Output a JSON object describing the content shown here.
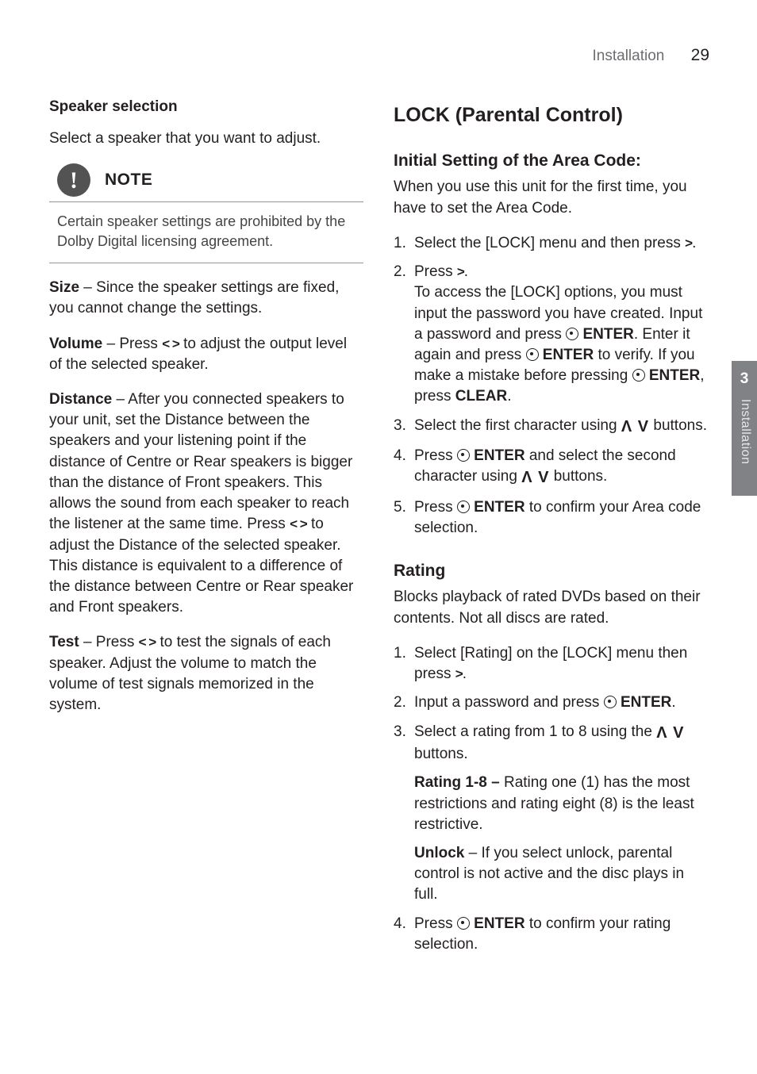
{
  "header": {
    "section": "Installation",
    "page": "29"
  },
  "sidetab": {
    "num": "3",
    "label": "Installation"
  },
  "left": {
    "h_speaker_sel": "Speaker selection",
    "speaker_sel_intro": "Select a speaker that you want to adjust.",
    "note_label": "NOTE",
    "note_body": "Certain speaker settings are prohibited by the Dolby Digital licensing agreement.",
    "size_label": "Size",
    "size_text": " – Since the speaker settings are fixed, you cannot change the settings.",
    "volume_label": "Volume",
    "volume_text_1": " – Press ",
    "volume_text_2": " to adjust the output level of the selected speaker.",
    "distance_label": "Distance",
    "distance_text_1": " – After you connected speakers to your unit, set the Distance between the speakers and your listening point if the distance of Centre or Rear speakers is bigger than the distance of Front speakers. This allows the sound from each speaker to reach the listener at the same time. Press ",
    "distance_text_2": " to adjust the Distance of the selected speaker. This distance is equivalent to a difference of the distance between Centre or Rear speaker and Front speakers.",
    "test_label": "Test",
    "test_text_1": " – Press ",
    "test_text_2": " to test the signals of each speaker. Adjust the volume to match the volume of test signals memorized in the system."
  },
  "right": {
    "h_lock": "LOCK (Parental Control)",
    "h_area": "Initial Setting of the Area Code:",
    "area_intro": "When you use this unit for the first time, you have to set the Area Code.",
    "area_s1": "Select the [LOCK] menu and then press ",
    "area_s2a": "Press ",
    "area_s2b": "To access the [LOCK] options, you must input the password you have created. Input a password and press ",
    "area_s2c": ". Enter it again and press ",
    "area_s2d": " to verify. If you make a mistake before pressing ",
    "area_s2e": ", press ",
    "area_s3": "Select the first character using ",
    "area_s3b": " buttons.",
    "area_s4a": "Press ",
    "area_s4b": " and select the second character using ",
    "area_s4c": " buttons.",
    "area_s5a": "Press ",
    "area_s5b": " to confirm your Area code selection.",
    "enter": "ENTER",
    "clear": "CLEAR",
    "h_rating": "Rating",
    "rating_intro": "Blocks playback of rated DVDs based on their contents. Not all discs are rated.",
    "rating_s1a": "Select [Rating] on the [LOCK] menu then press ",
    "rating_s2a": "Input a password and press ",
    "rating_s3a": "Select a rating from 1 to 8 using the ",
    "rating_s3b": " buttons.",
    "rating_r18_l": "Rating 1-8 – ",
    "rating_r18_t": "Rating one (1) has the most restrictions and rating eight (8) is the least restrictive.",
    "rating_unlock_l": "Unlock",
    "rating_unlock_t": " – If you select unlock, parental control is not active and the disc plays in full.",
    "rating_s4a": "Press ",
    "rating_s4b": " to confirm your rating selection."
  },
  "sym": {
    "lr": "< >",
    "r": ">",
    "ud": "Ʌ V"
  }
}
